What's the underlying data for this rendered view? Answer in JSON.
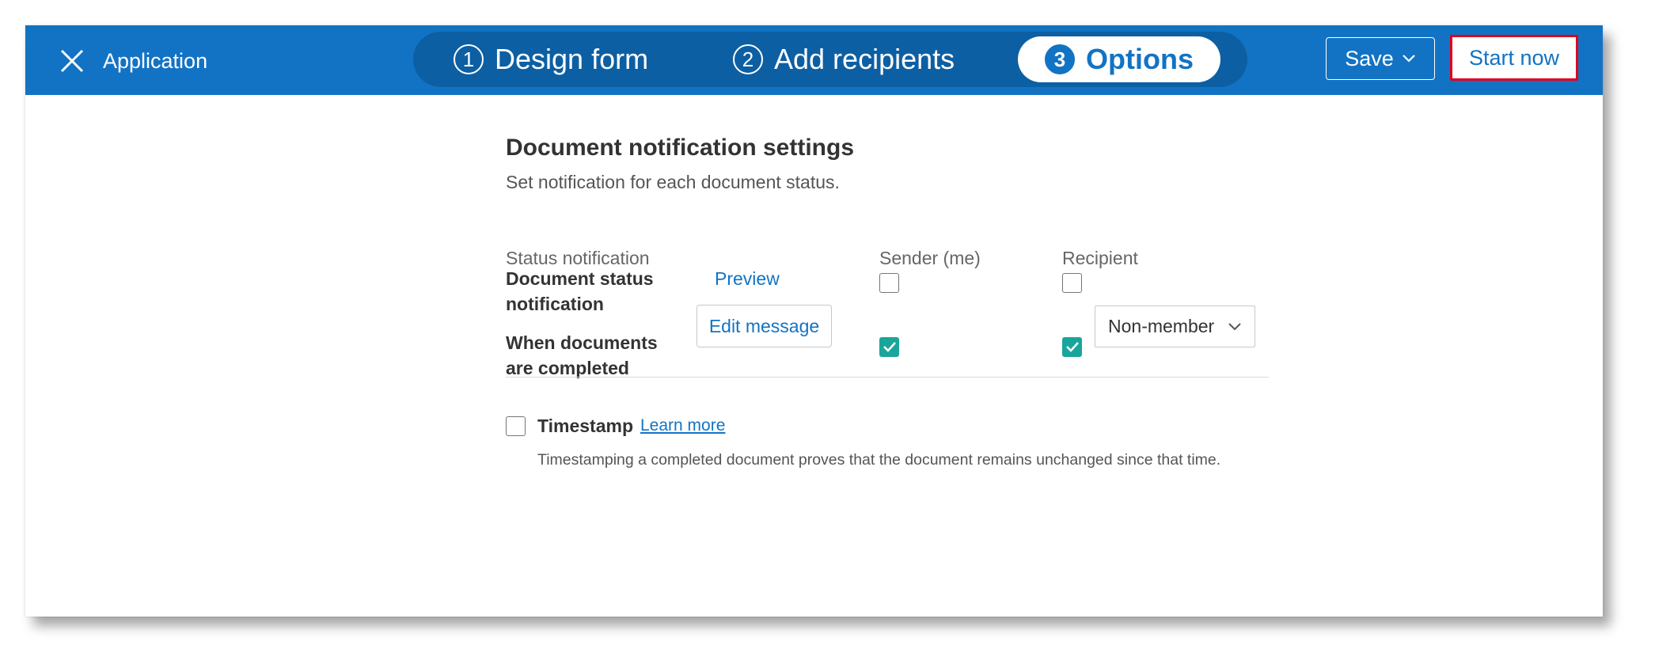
{
  "header": {
    "app_title": "Application",
    "steps": [
      {
        "number": "1",
        "label": "Design form",
        "active": false
      },
      {
        "number": "2",
        "label": "Add recipients",
        "active": false
      },
      {
        "number": "3",
        "label": "Options",
        "active": true
      }
    ],
    "save_label": "Save",
    "start_label": "Start now",
    "colors": {
      "header_bg": "#1273c4",
      "steps_track": "#0d5fa3",
      "highlight_border": "#e0001a"
    }
  },
  "settings": {
    "title": "Document notification settings",
    "subtitle": "Set notification for each document status.",
    "columns": {
      "status": "Status notification",
      "sender": "Sender (me)",
      "recipient": "Recipient"
    },
    "rows": [
      {
        "label": "Document status notification",
        "action": "Preview",
        "sender_checked": false,
        "recipient_checked": false
      },
      {
        "label": "When documents are completed",
        "action": "Edit message",
        "sender_checked": true,
        "recipient_checked": true,
        "recipient_type": "Non-member"
      }
    ],
    "check_color": "#1aa59a"
  },
  "timestamp": {
    "label": "Timestamp",
    "link": "Learn more",
    "description": "Timestamping a completed document proves that the document remains unchanged since that time.",
    "checked": false
  }
}
